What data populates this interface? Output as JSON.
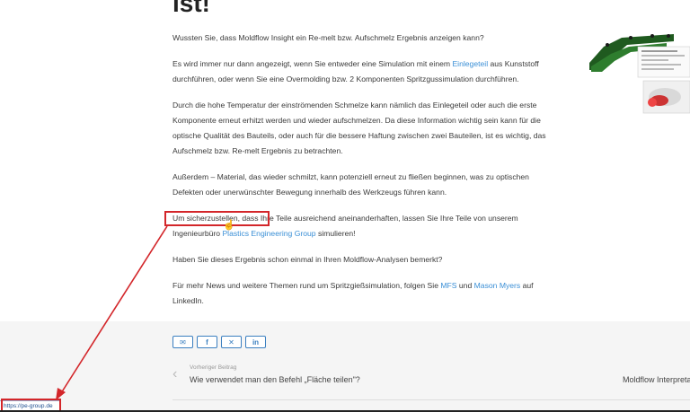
{
  "article": {
    "heading_fragment": "ist!",
    "paragraphs": {
      "p1": "Wussten Sie, dass Moldflow Insight ein Re-melt bzw. Aufschmelz Ergebnis anzeigen kann?",
      "p2_before": "Es wird immer nur dann angezeigt, wenn Sie entweder eine Simulation mit einem ",
      "p2_link": "Einlegeteil",
      "p2_after": " aus Kunststoff durchführen, oder wenn Sie eine Overmolding bzw. 2 Komponenten Spritzgussimulation durchführen.",
      "p3": "Durch die hohe Temperatur der einströmenden Schmelze kann nämlich das Einlegeteil oder auch die erste Komponente erneut erhitzt werden und wieder aufschmelzen. Da diese Information wichtig sein kann für die optische Qualität des Bauteils, oder auch für die bessere Haftung zwischen zwei Bauteilen, ist es wichtig, das Aufschmelz bzw. Re-melt Ergebnis zu betrachten.",
      "p4": "Außerdem – Material, das wieder schmilzt, kann potenziell erneut zu fließen beginnen, was zu optischen Defekten oder unerwünschter Bewegung innerhalb des Werkzeugs führen kann.",
      "p5_before": "Um sicherzustellen, dass Ihre Teile ausreichend aneinanderhaften, lassen Sie Ihre Teile von unserem Ingenieurbüro ",
      "p5_link": "Plastics Engineering Group",
      "p5_after": " simulieren!",
      "p6": "Haben Sie dieses Ergebnis schon einmal in Ihren Moldflow-Analysen bemerkt?",
      "p7_before": "Für mehr News und weitere Themen rund um Spritzgießsimulation, folgen Sie ",
      "p7_link1": "MFS",
      "p7_mid": " und ",
      "p7_link2": "Mason Myers",
      "p7_after": " auf LinkedIn."
    }
  },
  "share": {
    "email_icon": "envelope-icon",
    "facebook_icon": "facebook-icon",
    "x_icon": "x-icon",
    "linkedin_icon": "linkedin-icon"
  },
  "post_nav": {
    "prev_label": "Vorheriger Beitrag",
    "prev_title": "Wie verwendet man den Befehl „Fläche teilen\"?",
    "next_title": "Moldflow Interpreta"
  },
  "status_bar": {
    "url": "https://pe-group.de"
  },
  "colors": {
    "link": "#3a8fd6",
    "annotation_red": "#d3262a",
    "share_border": "#3b7fc0"
  }
}
